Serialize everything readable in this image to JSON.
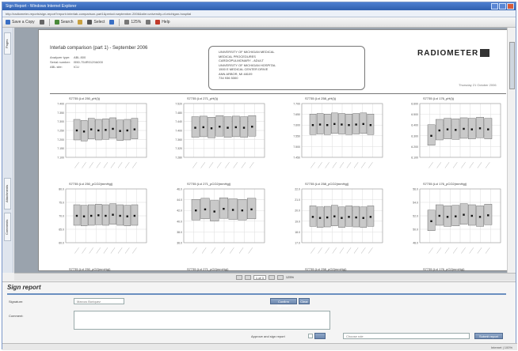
{
  "window": {
    "title": "Sign Report - Windows Internet Explorer",
    "address": "http://radiometer-reports/sign-report?report=interlab-comparison-part1&period=september-2006&site=university-of-michigan-hospital"
  },
  "toolbar": {
    "items": [
      {
        "label": "Save a Copy",
        "icon": "save-icon",
        "color": "#3a6fc4"
      },
      {
        "label": "",
        "icon": "print-icon",
        "color": "#666666"
      },
      {
        "label": "Search",
        "icon": "search-icon",
        "color": "#4a8a3a"
      },
      {
        "label": "",
        "icon": "hand-icon",
        "color": "#c8a040"
      },
      {
        "label": "Select",
        "icon": "select-icon",
        "color": "#555555"
      },
      {
        "label": "",
        "icon": "zoom-icon",
        "color": "#3a6fc4"
      },
      {
        "label": "125%",
        "icon": "zoom-out-icon",
        "color": "#777777"
      },
      {
        "label": "",
        "icon": "page-icon",
        "color": "#777777"
      },
      {
        "label": "Help",
        "icon": "help-icon",
        "color": "#c03a2a"
      }
    ]
  },
  "left_rail": {
    "tabs": [
      "Pages",
      "Attachments",
      "Comments"
    ]
  },
  "report": {
    "title": "Interlab comparison (part 1) - September 2006",
    "meta": [
      {
        "k": "Analyzer type:",
        "v": "ABL 800"
      },
      {
        "k": "Serial number:",
        "v": "I550-754R0129A000"
      },
      {
        "k": "ABL site:",
        "v": "ICU"
      }
    ],
    "address_lines": [
      "UNIVERSITY OF MICHIGAN MEDICAL",
      "MEDICAL PROCEDURES",
      "CARDIOPULMONARY - ADULT",
      "UNIVERSITY OF MICHIGAN HOSPITAL",
      "1500 E MEDICAL CENTER DRIVE",
      "ANN ARBOR, MI 48109",
      "734 936 5300"
    ],
    "brand": "RADIOMETER",
    "printed": "Thursday 21 October 2006"
  },
  "charts": [
    {
      "title": "S7735 (Lvl 250_pH(l))",
      "ylabels": [
        "7.400",
        "7.350",
        "7.300",
        "7.250",
        "7.200",
        "7.150",
        "7.100"
      ],
      "series": [
        0.5,
        0.48,
        0.52,
        0.5,
        0.51,
        0.53,
        0.49,
        0.5,
        0.52
      ]
    },
    {
      "title": "S7735 (Lvl 271_pH(l))",
      "ylabels": [
        "7.520",
        "7.480",
        "7.440",
        "7.400",
        "7.360",
        "7.320",
        "7.280"
      ],
      "series": [
        0.55,
        0.56,
        0.54,
        0.57,
        0.55,
        0.56,
        0.55,
        0.57
      ]
    },
    {
      "title": "S7735 (Lvl 258_pH(l))",
      "ylabels": [
        "7.700",
        "7.650",
        "7.600",
        "7.550",
        "7.500",
        "7.450"
      ],
      "series": [
        0.6,
        0.61,
        0.6,
        0.62,
        0.61,
        0.6,
        0.61,
        0.62,
        0.6
      ]
    },
    {
      "title": "S7735 (Lvl 176_pH(l))",
      "ylabels": [
        "6.600",
        "6.500",
        "6.400",
        "6.300",
        "6.200",
        "6.100"
      ],
      "series": [
        0.4,
        0.5,
        0.52,
        0.51,
        0.53,
        0.52,
        0.54,
        0.52
      ]
    },
    {
      "title": "S7735 (Lvl 250_pCO2(mmHg))",
      "ylabels": [
        "80.0",
        "75.0",
        "70.0",
        "65.0",
        "60.0"
      ],
      "series": [
        0.5,
        0.49,
        0.5,
        0.51,
        0.5,
        0.52,
        0.5,
        0.49,
        0.5
      ]
    },
    {
      "title": "S7735 (Lvl 271_pCO2(mmHg))",
      "ylabels": [
        "46.0",
        "44.0",
        "42.0",
        "40.0",
        "38.0",
        "36.0"
      ],
      "series": [
        0.6,
        0.62,
        0.58,
        0.63,
        0.61,
        0.6,
        0.62
      ]
    },
    {
      "title": "S7735 (Lvl 258_pCO2(mmHg))",
      "ylabels": [
        "22.0",
        "21.0",
        "20.0",
        "19.0",
        "18.0",
        "17.0"
      ],
      "series": [
        0.48,
        0.46,
        0.47,
        0.49,
        0.46,
        0.48,
        0.47,
        0.46,
        0.48
      ]
    },
    {
      "title": "S7735 (Lvl 176_pCO2(mmHg))",
      "ylabels": [
        "56.0",
        "54.0",
        "52.0",
        "50.0",
        "48.0"
      ],
      "series": [
        0.4,
        0.5,
        0.48,
        0.49,
        0.52,
        0.5,
        0.48,
        0.51
      ]
    }
  ],
  "charts_partial": [
    "S7735 (Lvl 250_pO2(mmHg))",
    "S7735 (Lvl 271_pO2(mmHg))",
    "S7735 (Lvl 258_pO2(mmHg))",
    "S7735 (Lvl 176_pO2(mmHg))"
  ],
  "nav": {
    "page": "1 of 3",
    "zoom": "125%"
  },
  "sign": {
    "title": "Sign report",
    "signature_label": "Signature:",
    "signature_value": "Marcus Boriquez",
    "confirm_label": "Confirm Signature",
    "clear_label": "Clear",
    "comment_label": "Comment:",
    "approve_label": "Approve and sign report",
    "role_placeholder": "Choose role",
    "submit_label": "Submit report"
  },
  "status": {
    "left": "",
    "right": "Internet | 100%"
  }
}
